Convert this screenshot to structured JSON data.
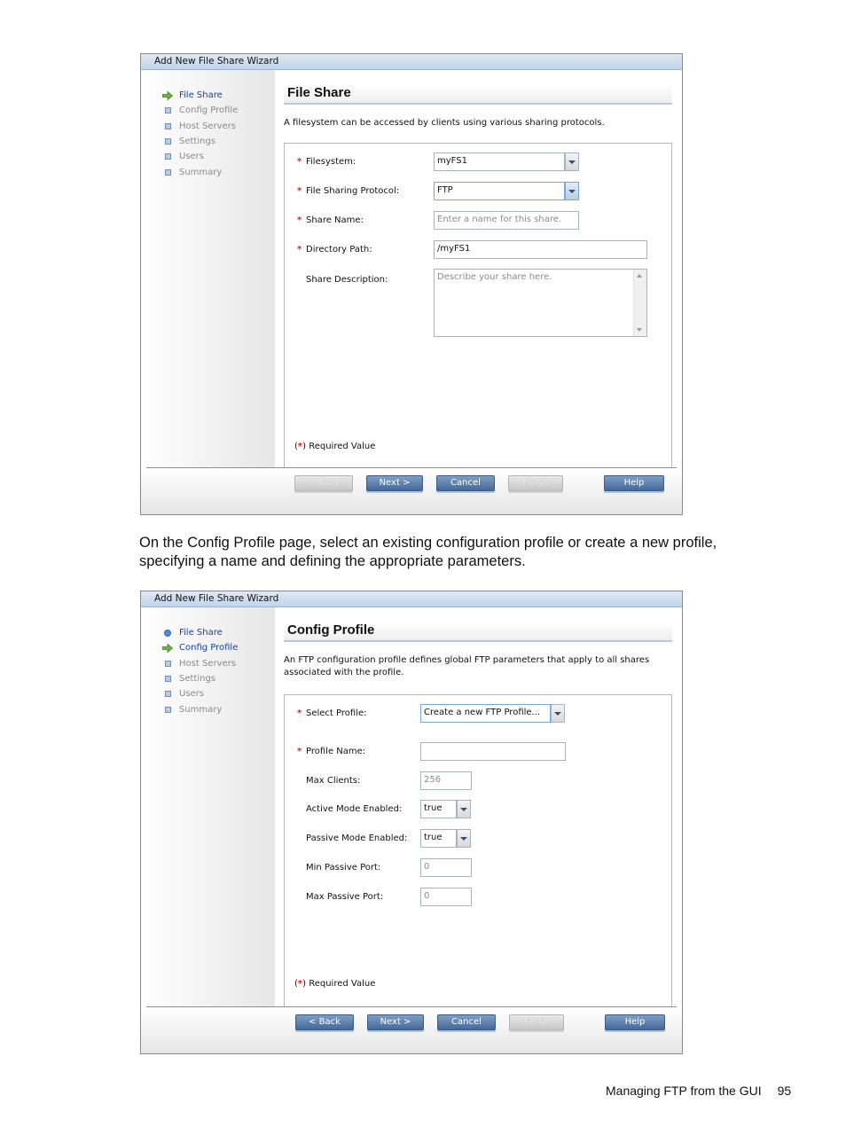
{
  "wizard1": {
    "title": "Add New File Share Wizard",
    "steps": [
      {
        "label": "File Share",
        "state": "current"
      },
      {
        "label": "Config Profile",
        "state": "pending"
      },
      {
        "label": "Host Servers",
        "state": "pending"
      },
      {
        "label": "Settings",
        "state": "pending"
      },
      {
        "label": "Users",
        "state": "pending"
      },
      {
        "label": "Summary",
        "state": "pending"
      }
    ],
    "page_title": "File Share",
    "intro": "A filesystem can be accessed by clients using various sharing protocols.",
    "fields": {
      "filesystem": {
        "label": "Filesystem:",
        "value": "myFS1"
      },
      "protocol": {
        "label": "File Sharing Protocol:",
        "value": "FTP"
      },
      "share_name": {
        "label": "Share Name:",
        "placeholder": "Enter a name for this share."
      },
      "directory_path": {
        "label": "Directory Path:",
        "value": "/myFS1"
      },
      "share_description": {
        "label": "Share Description:",
        "placeholder": "Describe your share here."
      }
    },
    "required_note_open": "(",
    "required_note_star": "*",
    "required_note_close": ") Required Value",
    "buttons": {
      "back": "< Back",
      "next": "Next >",
      "cancel": "Cancel",
      "finish": "Finish",
      "help": "Help"
    }
  },
  "prose": "On the Config Profile page, select an existing configuration profile or create a new profile, specifying a name and defining the appropriate parameters.",
  "wizard2": {
    "title": "Add New File Share Wizard",
    "steps": [
      {
        "label": "File Share",
        "state": "done"
      },
      {
        "label": "Config Profile",
        "state": "current"
      },
      {
        "label": "Host Servers",
        "state": "pending"
      },
      {
        "label": "Settings",
        "state": "pending"
      },
      {
        "label": "Users",
        "state": "pending"
      },
      {
        "label": "Summary",
        "state": "pending"
      }
    ],
    "page_title": "Config Profile",
    "intro": "An FTP configuration profile defines global FTP parameters that apply to all shares associated with the profile.",
    "fields": {
      "select_profile": {
        "label": "Select Profile:",
        "value": "Create a new FTP Profile..."
      },
      "profile_name": {
        "label": "Profile Name:",
        "value": ""
      },
      "max_clients": {
        "label": "Max Clients:",
        "value": "256"
      },
      "active_mode": {
        "label": "Active Mode Enabled:",
        "value": "true"
      },
      "passive_mode": {
        "label": "Passive Mode Enabled:",
        "value": "true"
      },
      "min_passive_port": {
        "label": "Min Passive Port:",
        "value": "0"
      },
      "max_passive_port": {
        "label": "Max Passive Port:",
        "value": "0"
      }
    },
    "required_note_open": "(",
    "required_note_star": "*",
    "required_note_close": ") Required Value",
    "buttons": {
      "back": "< Back",
      "next": "Next >",
      "cancel": "Cancel",
      "finish": "Finish",
      "help": "Help"
    }
  },
  "page_footer": {
    "section": "Managing FTP from the GUI",
    "page_number": "95"
  },
  "icons": {
    "current_step": "arrow-right-icon",
    "pending_step": "square-bullet-icon",
    "done_step": "dot-bullet-icon",
    "dropdown": "chevron-down-icon"
  }
}
